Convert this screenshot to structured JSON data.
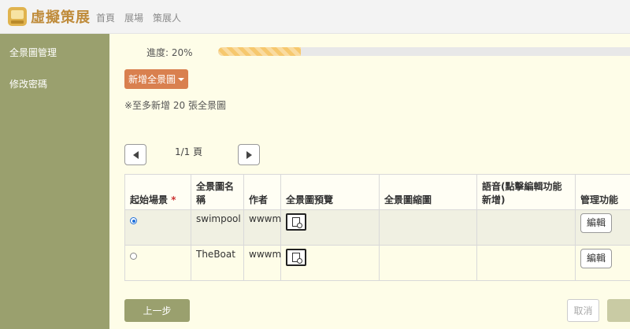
{
  "brand": {
    "logo_text": "虛擬策展",
    "accent": "#bf8b3a"
  },
  "topnav": {
    "items": [
      "首頁",
      "展場",
      "策展人"
    ]
  },
  "sidebar": {
    "items": [
      {
        "label": "全景圖管理"
      },
      {
        "label": "修改密碼"
      }
    ],
    "color": "#9aa06e"
  },
  "progress": {
    "label": "進度: 20%",
    "value": 0.2
  },
  "toolbar": {
    "add_label": "新增全景圖"
  },
  "note": "※至多新增 20 張全景圖",
  "pagination": {
    "info": "1/1 頁"
  },
  "table": {
    "headers": {
      "start": "起始場景",
      "required_mark": "*",
      "name": "全景圖名稱",
      "author": "作者",
      "preview": "全景圖預覽",
      "thumb": "全景圖縮圖",
      "audio": "語音(點擊編輯功能新增)",
      "manage": "管理功能"
    },
    "rows": [
      {
        "selected": true,
        "name": "swimpool",
        "author": "wwwm",
        "thumb": "",
        "audio": "",
        "edit_label": "編輯"
      },
      {
        "selected": false,
        "name": "TheBoat",
        "author": "wwwm",
        "thumb": "",
        "audio": "",
        "edit_label": "編輯"
      }
    ]
  },
  "footer": {
    "prev_label": "上一步",
    "cancel_label": "取消"
  }
}
